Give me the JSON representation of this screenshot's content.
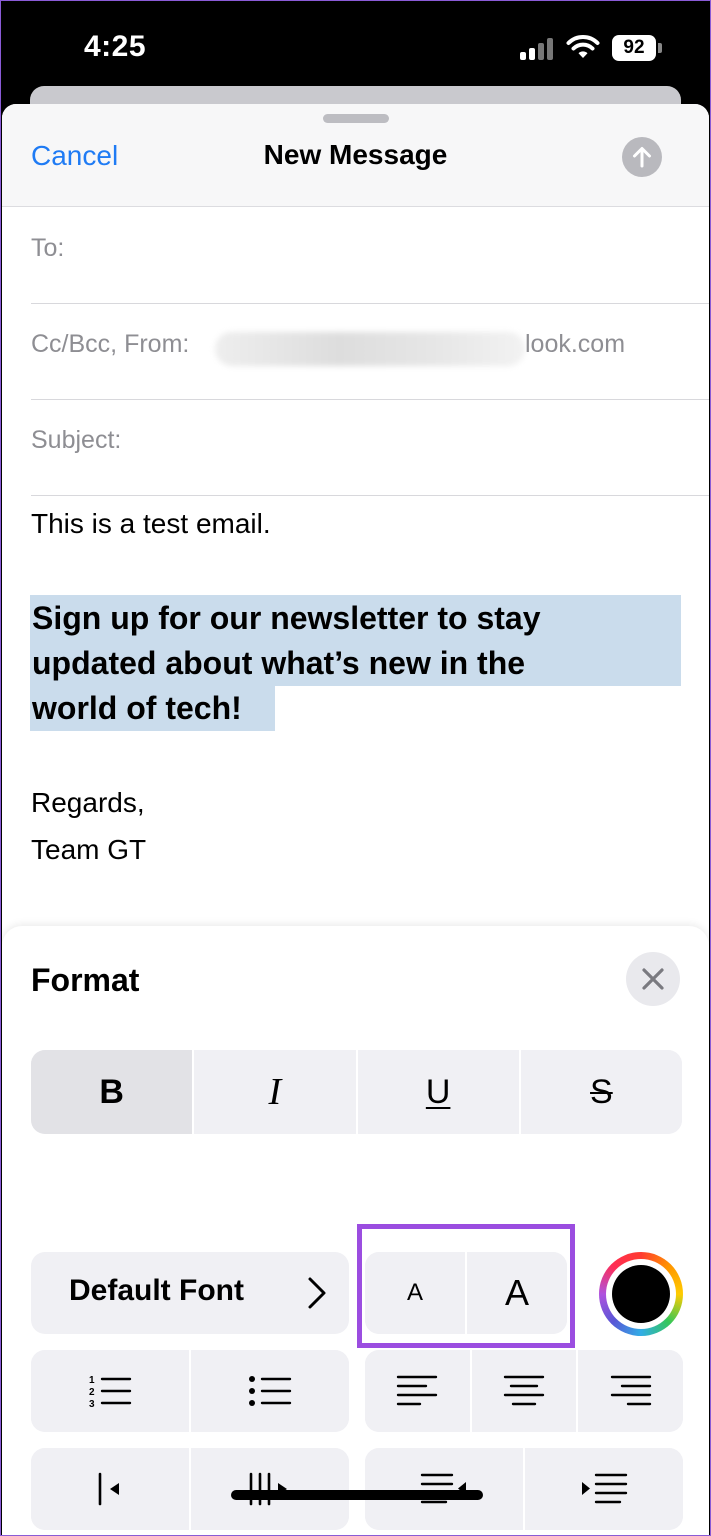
{
  "status_bar": {
    "time": "4:25",
    "battery": "92"
  },
  "compose": {
    "cancel_label": "Cancel",
    "title": "New Message",
    "to_label": "To:",
    "ccbcc_label": "Cc/Bcc, From:",
    "from_visible_suffix": "look.com",
    "subject_label": "Subject:"
  },
  "body": {
    "line1": "This is a test email.",
    "highlight_lines": [
      "Sign up for our newsletter to stay",
      "updated about what’s new in the",
      "world of tech!"
    ],
    "regards": "Regards,",
    "signature": "Team GT"
  },
  "format_panel": {
    "title": "Format",
    "style_buttons": {
      "bold": "B",
      "italic": "I",
      "underline": "U",
      "strikethrough": "S"
    },
    "font_label": "Default Font",
    "size_small": "A",
    "size_large": "A",
    "text_color": "#000000",
    "highlight_outline_color": "#9b4de0"
  },
  "colors": {
    "accent": "#1f7bf4",
    "selection": "#cadcec"
  }
}
